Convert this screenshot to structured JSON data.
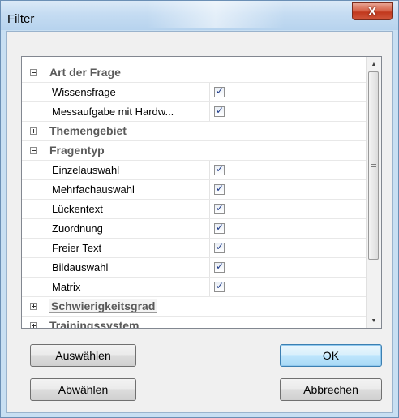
{
  "window": {
    "title": "Filter",
    "close_label": "X"
  },
  "tree": {
    "rows": [
      {
        "kind": "group",
        "label": "Art der Frage",
        "expanded": true
      },
      {
        "kind": "item",
        "label": "Wissensfrage",
        "checked": true
      },
      {
        "kind": "item",
        "label": "Messaufgabe mit Hardw...",
        "checked": true
      },
      {
        "kind": "group",
        "label": "Themengebiet",
        "expanded": false
      },
      {
        "kind": "group",
        "label": "Fragentyp",
        "expanded": true
      },
      {
        "kind": "item",
        "label": "Einzelauswahl",
        "checked": true
      },
      {
        "kind": "item",
        "label": "Mehrfachauswahl",
        "checked": true
      },
      {
        "kind": "item",
        "label": "Lückentext",
        "checked": true
      },
      {
        "kind": "item",
        "label": "Zuordnung",
        "checked": true
      },
      {
        "kind": "item",
        "label": "Freier Text",
        "checked": true
      },
      {
        "kind": "item",
        "label": "Bildauswahl",
        "checked": true
      },
      {
        "kind": "item",
        "label": "Matrix",
        "checked": true
      },
      {
        "kind": "group",
        "label": "Schwierigkeitsgrad",
        "expanded": false,
        "focused": true
      },
      {
        "kind": "group",
        "label": "Trainingssystem",
        "expanded": false,
        "partial": true
      }
    ]
  },
  "buttons": {
    "select": "Auswählen",
    "deselect": "Abwählen",
    "ok": "OK",
    "cancel": "Abbrechen"
  }
}
